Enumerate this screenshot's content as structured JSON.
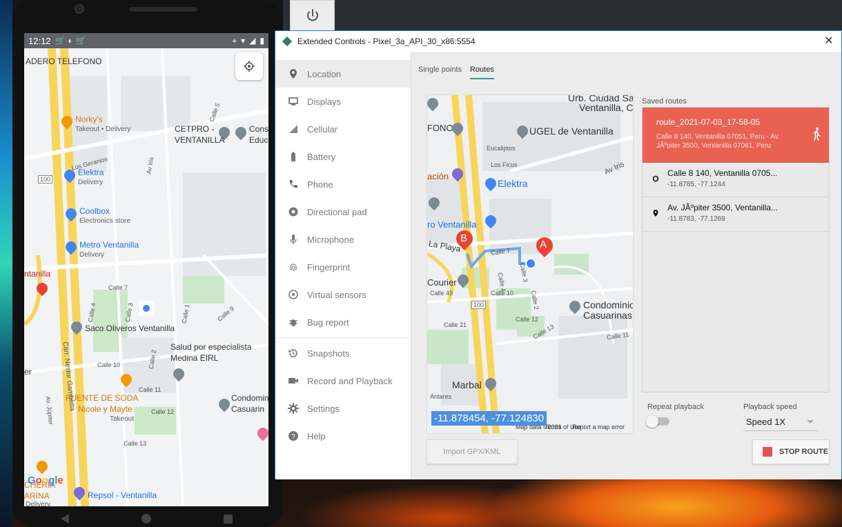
{
  "window": {
    "title": "Extended Controls - Pixel_3a_API_30_x86:5554",
    "close_glyph": "✕"
  },
  "sidebar": {
    "items": [
      {
        "label": "Location",
        "icon": "location-pin-icon"
      },
      {
        "label": "Displays",
        "icon": "display-icon"
      },
      {
        "label": "Cellular",
        "icon": "cellular-signal-icon"
      },
      {
        "label": "Battery",
        "icon": "battery-icon"
      },
      {
        "label": "Phone",
        "icon": "phone-icon"
      },
      {
        "label": "Directional pad",
        "icon": "dpad-icon"
      },
      {
        "label": "Microphone",
        "icon": "microphone-icon"
      },
      {
        "label": "Fingerprint",
        "icon": "fingerprint-icon"
      },
      {
        "label": "Virtual sensors",
        "icon": "virtual-sensors-icon"
      },
      {
        "label": "Bug report",
        "icon": "bug-icon"
      },
      {
        "label": "Snapshots",
        "icon": "history-icon"
      },
      {
        "label": "Record and Playback",
        "icon": "video-camera-icon"
      },
      {
        "label": "Settings",
        "icon": "gear-icon"
      },
      {
        "label": "Help",
        "icon": "help-icon"
      }
    ],
    "active_index": 0
  },
  "tabs": {
    "single_points": "Single points",
    "routes": "Routes",
    "active": "routes"
  },
  "map": {
    "coordinate_tooltip": "-11.878454, -77.124830",
    "footer_data": "Map data ©2021",
    "footer_terms": "Terms of Use",
    "footer_report": "Report a map error",
    "labels": {
      "urb": "Urb. Ciudad Sat",
      "ventanilla_c": "Ventanilla, C",
      "ugel": "UGEL de Ventanilla",
      "fono": "FONO",
      "eucaliptos": "Eucaliptos",
      "los_ficus": "Los Ficus",
      "av_iris": "Av Iris",
      "elektra": "Elektra",
      "acion": "ación",
      "ro_ventanilla": "ro Ventanilla",
      "la_playa": "La Playa",
      "calle7": "Calle 7",
      "calle3": "Calle 3",
      "calle4": "Calle 4",
      "courier": "Courier",
      "calle49": "Calle 49",
      "calle10": "Calle 10",
      "calle2": "Calle 2",
      "condominio": "Condominio",
      "casuarinas": "Casuarinas",
      "calle12": "Calle 12",
      "calle13": "Calle 13",
      "calle21": "Calle 21",
      "calle11": "Calle 11",
      "marbal": "Marbal",
      "antares": "Antares",
      "hwy": "100",
      "marker_a": "A",
      "marker_b": "B"
    }
  },
  "saved_routes": {
    "title": "Saved routes",
    "selected": {
      "name": "route_2021-07-03_17-58-05",
      "description": "Calle 8 140, Ventanilla 07051, Peru - Av. JÃºpiter 3500, Ventanilla 07061, Peru"
    },
    "points": [
      {
        "title": "Calle 8 140, Ventanilla 0705...",
        "coords": "-11.8785, -77.1244",
        "marker": "start-circle-icon"
      },
      {
        "title": "Av. JÃºpiter 3500, Ventanilla...",
        "coords": "-11.8783, -77.1269",
        "marker": "destination-pin-icon"
      }
    ]
  },
  "playback": {
    "repeat_label": "Repeat playback",
    "repeat_on": false,
    "speed_label": "Playback speed",
    "speed_value": "Speed 1X"
  },
  "buttons": {
    "import": "Import GPX/KML",
    "stop": "STOP ROUTE"
  },
  "phone": {
    "time": "12:12",
    "map_labels": {
      "adero": "ADERO TELEFONO",
      "norkys": "Norky's",
      "norkys_sub": "Takeout • Delivery",
      "cetpro": "CETPRO -",
      "cetpro2": "VENTANILLA",
      "cons": "Cons",
      "educ": "Educ",
      "los_geranios": "Los Geranios",
      "av_iris": "Av Iris",
      "elektra": "Elektra",
      "elektra_sub": "Delivery",
      "coolbox": "Coolbox",
      "coolbox_sub": "Electronics store",
      "metro": "Metro Ventanilla",
      "metro_sub": "Delivery",
      "ntanilla": "ntanilla",
      "saco": "Saco Oliveros Ventanilla",
      "salud": "Salud por especialista",
      "salud2": "Medina EIRL",
      "fuente": "FUENTE DE SODA",
      "fuente2": "Nicole y Mayte",
      "fuente_sub": "Takeout",
      "condomin": "Condomin",
      "casuarin": "Casuarin",
      "cheria": "CHERIA",
      "arina": "ARINA",
      "delivery": "Delivery",
      "repsol": "Repsol - Ventanilla",
      "hwy": "100",
      "carr": "Carr. Nestor Gambetta",
      "av_jupiter": "Av. Júpiter",
      "calle5": "Calle 5",
      "calle7": "Calle 7",
      "calle4": "Calle 4",
      "calle3": "Calle 3",
      "calle1": "Calle 1",
      "calle9": "Calle 9",
      "calle10": "Calle 10",
      "calle2": "Calle 2",
      "calle11": "Calle 11",
      "calle12": "Calle 12",
      "calle13": "Calle 13",
      "er": "er"
    }
  },
  "colors": {
    "accent_teal": "#2e9c8c",
    "route_card": "#e96152",
    "coord_tooltip": "#4d90e0",
    "stop_square": "#e05555"
  }
}
